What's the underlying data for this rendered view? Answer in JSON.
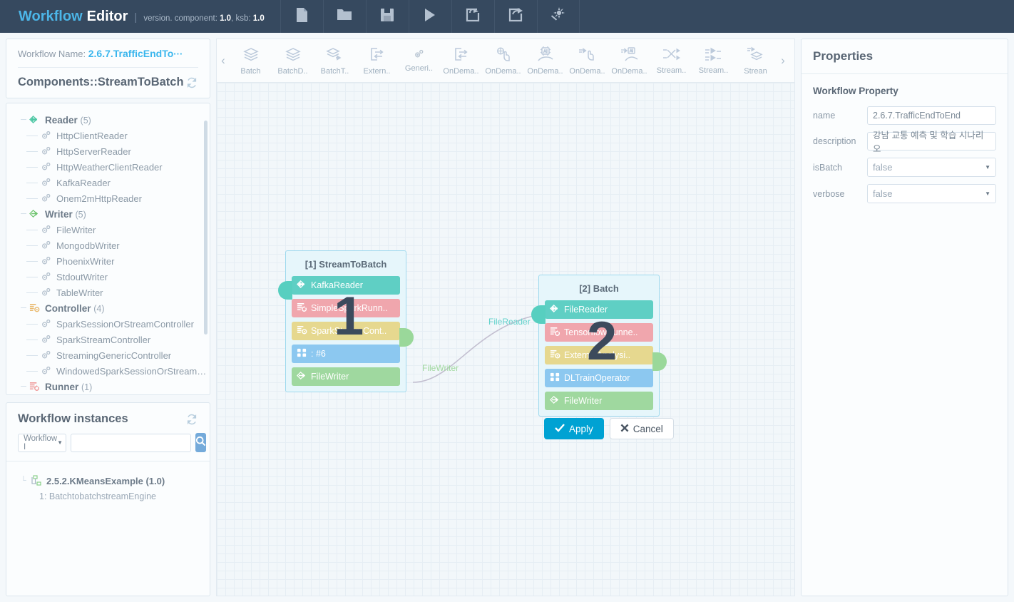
{
  "header": {
    "brand_1": "Workflow",
    "brand_2": "Editor",
    "separator": "|",
    "version_prefix": "version. component",
    "version_component": "1.0",
    "version_ksb_label": ", ksb",
    "version_ksb": "1.0",
    "buttons": [
      {
        "name": "new-file-icon",
        "label": "New"
      },
      {
        "name": "open-folder-icon",
        "label": "Open"
      },
      {
        "name": "save-icon",
        "label": "Save"
      },
      {
        "name": "run-icon",
        "label": "Run"
      },
      {
        "name": "import-icon",
        "label": "Import"
      },
      {
        "name": "export-icon",
        "label": "Export"
      },
      {
        "name": "magic-wand-icon",
        "label": "Auto"
      }
    ]
  },
  "sidebar": {
    "workflow_name_label": "Workflow Name:",
    "workflow_name_value": "2.6.7.TrafficEndTo",
    "workflow_name_ellipsis": "···",
    "components_title": "Components::StreamToBatch",
    "refresh_icon": "refresh-icon",
    "tree": [
      {
        "type": "group",
        "icon": "reader-arrow-icon",
        "label": "Reader",
        "count": "(5)"
      },
      {
        "type": "leaf",
        "icon": "gears-icon",
        "label": "HttpClientReader"
      },
      {
        "type": "leaf",
        "icon": "gears-icon",
        "label": "HttpServerReader"
      },
      {
        "type": "leaf",
        "icon": "gears-icon",
        "label": "HttpWeatherClientReader"
      },
      {
        "type": "leaf",
        "icon": "gears-icon",
        "label": "KafkaReader"
      },
      {
        "type": "leaf",
        "icon": "gears-icon",
        "label": "Onem2mHttpReader"
      },
      {
        "type": "group",
        "icon": "writer-arrow-icon",
        "label": "Writer",
        "count": "(5)"
      },
      {
        "type": "leaf",
        "icon": "gears-icon",
        "label": "FileWriter"
      },
      {
        "type": "leaf",
        "icon": "gears-icon",
        "label": "MongodbWriter"
      },
      {
        "type": "leaf",
        "icon": "gears-icon",
        "label": "PhoenixWriter"
      },
      {
        "type": "leaf",
        "icon": "gears-icon",
        "label": "StdoutWriter"
      },
      {
        "type": "leaf",
        "icon": "gears-icon",
        "label": "TableWriter"
      },
      {
        "type": "group",
        "icon": "controller-icon",
        "label": "Controller",
        "count": "(4)"
      },
      {
        "type": "leaf",
        "icon": "gears-icon",
        "label": "SparkSessionOrStreamController"
      },
      {
        "type": "leaf",
        "icon": "gears-icon",
        "label": "SparkStreamController"
      },
      {
        "type": "leaf",
        "icon": "gears-icon",
        "label": "StreamingGenericController"
      },
      {
        "type": "leaf",
        "icon": "gears-icon",
        "label": "WindowedSparkSessionOrStream…"
      },
      {
        "type": "group",
        "icon": "runner-icon",
        "label": "Runner",
        "count": "(1)"
      }
    ]
  },
  "instances": {
    "title": "Workflow instances",
    "refresh_icon": "refresh-icon",
    "filter_value": "Workflow I",
    "search_value": "",
    "search_placeholder": "",
    "search_button_icon": "search-icon",
    "rows": [
      {
        "icon": "workflow-instance-icon",
        "label": "2.5.2.KMeansExample (1.0)"
      },
      {
        "label": "1: BatchtobatchstreamEngine"
      }
    ]
  },
  "palette": {
    "prev_arrow": "‹",
    "next_arrow": "›",
    "items": [
      {
        "label": "Batch",
        "icon": "layers-icon"
      },
      {
        "label": "BatchD..",
        "icon": "layers-icon"
      },
      {
        "label": "BatchT..",
        "icon": "layers-arrow-icon"
      },
      {
        "label": "Extern..",
        "icon": "external-exchange-icon"
      },
      {
        "label": "Generi..",
        "icon": "gears-icon"
      },
      {
        "label": "OnDema..",
        "icon": "external-exchange-icon"
      },
      {
        "label": "OnDema..",
        "icon": "ondemand-hand-icon"
      },
      {
        "label": "OnDema..",
        "icon": "ondemand-ai-icon"
      },
      {
        "label": "OnDema..",
        "icon": "ondemand-stream-hand-icon"
      },
      {
        "label": "OnDema..",
        "icon": "ondemand-stream-ai-icon"
      },
      {
        "label": "Stream..",
        "icon": "stream-cross-icon"
      },
      {
        "label": "Stream..",
        "icon": "stream-arrows-icon"
      },
      {
        "label": "Strean",
        "icon": "stream-layers-icon"
      }
    ]
  },
  "canvas": {
    "nodes": [
      {
        "title": "[1] StreamToBatch",
        "badge": "1",
        "slots": [
          {
            "label": "KafkaReader",
            "icon": "reader-arrow-icon",
            "color": "#5fcfc4"
          },
          {
            "label": "SimpleSparkRunn..",
            "icon": "runner-icon",
            "color": "#f0a6ad"
          },
          {
            "label": "SparkStreamCont..",
            "icon": "controller-icon",
            "color": "#e6d88f"
          },
          {
            "label": ": #6",
            "icon": "operator-grid-icon",
            "color": "#8cc8f0"
          },
          {
            "label": "FileWriter",
            "icon": "writer-arrow-icon",
            "color": "#9fd89f"
          }
        ]
      },
      {
        "title": "[2] Batch",
        "badge": "2",
        "slots": [
          {
            "label": "FileReader",
            "icon": "reader-arrow-icon",
            "color": "#5fcfc4"
          },
          {
            "label": "TensorflowRunne..",
            "icon": "runner-icon",
            "color": "#f0a6ad"
          },
          {
            "label": "ExternalAnalysi..",
            "icon": "controller-icon",
            "color": "#e6d88f"
          },
          {
            "label": "DLTrainOperator",
            "icon": "operator-grid-icon",
            "color": "#8cc8f0"
          },
          {
            "label": "FileWriter",
            "icon": "writer-arrow-icon",
            "color": "#9fd89f"
          }
        ]
      }
    ],
    "connection_labels": [
      {
        "text": "FileReader",
        "color": "#64d3cc"
      },
      {
        "text": "FileWriter",
        "color": "#a0d89f"
      }
    ],
    "apply_label": "Apply",
    "cancel_label": "Cancel",
    "apply_icon": "check-icon",
    "cancel_icon": "close-x-icon",
    "apply_color": "#00a2d3"
  },
  "properties": {
    "title": "Properties",
    "section": "Workflow Property",
    "fields": [
      {
        "label": "name",
        "value": "2.6.7.TrafficEndToEnd",
        "kind": "text"
      },
      {
        "label": "description",
        "value": "강남 교통 예측 및 학습 시나리오",
        "kind": "text"
      },
      {
        "label": "isBatch",
        "value": "false",
        "kind": "select"
      },
      {
        "label": "verbose",
        "value": "false",
        "kind": "select"
      }
    ]
  }
}
